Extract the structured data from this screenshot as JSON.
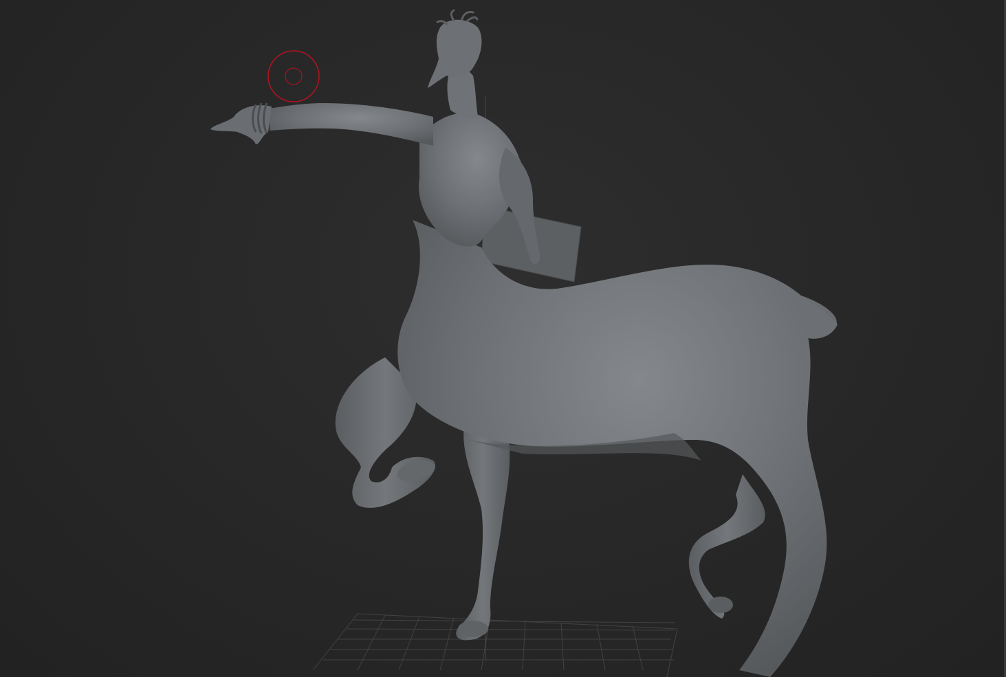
{
  "viewport": {
    "background_color": "#262626",
    "model_color": "#6d7074",
    "model_shadow_color": "#4e5154",
    "model_highlight_color": "#868a8e",
    "grid_color": "#4a4a4a",
    "axis_color": "#2f7a3a",
    "brush_cursor_color": "#b4141e"
  },
  "scene": {
    "model": "centaur-sculpt",
    "brush_cursor": "draw-size-ring",
    "floor_grid": "visible"
  }
}
